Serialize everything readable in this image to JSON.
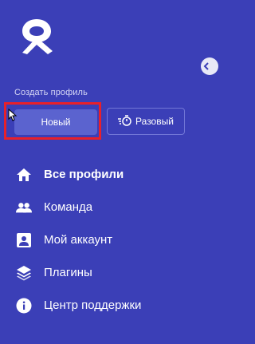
{
  "create_profile": {
    "label": "Создать профиль",
    "new_button": "Новый",
    "one_time_button": "Разовый"
  },
  "nav": {
    "items": [
      {
        "label": "Все профили",
        "icon": "home-icon",
        "active": true
      },
      {
        "label": "Команда",
        "icon": "team-icon"
      },
      {
        "label": "Мой аккаунт",
        "icon": "account-icon"
      },
      {
        "label": "Плагины",
        "icon": "plugins-icon"
      },
      {
        "label": "Центр поддержки",
        "icon": "info-icon"
      }
    ]
  },
  "colors": {
    "sidebar_bg": "#3b3fb7",
    "primary_button": "#5b63cf",
    "highlight": "#e8202a"
  }
}
